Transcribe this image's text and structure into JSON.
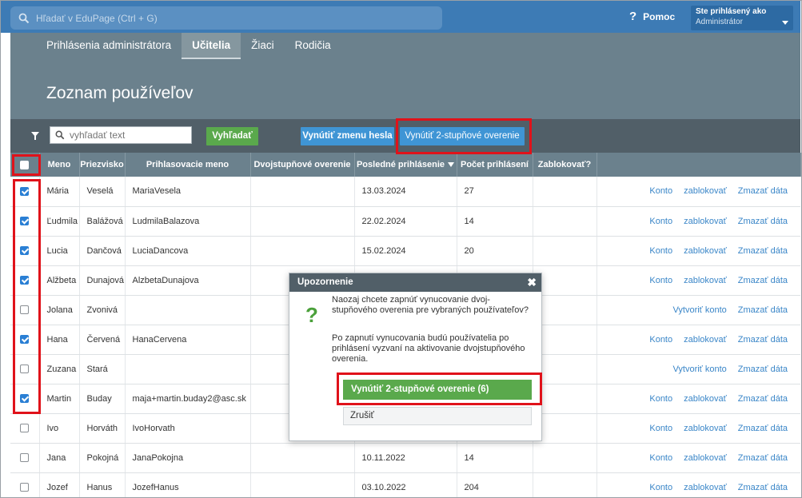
{
  "topbar": {
    "search_placeholder": "Hľadať v EduPage (Ctrl + G)",
    "help_label": "Pomoc",
    "user_label": "Ste prihlásený ako",
    "user_role": "Administrátor"
  },
  "tabs": [
    {
      "label": "Prihlásenia administrátora",
      "active": false
    },
    {
      "label": "Učitelia",
      "active": true
    },
    {
      "label": "Žiaci",
      "active": false
    },
    {
      "label": "Rodičia",
      "active": false
    }
  ],
  "page_title": "Zoznam používeľov",
  "toolbar": {
    "search_placeholder": "vyhľadať text",
    "search_button": "Vyhľadať",
    "reset_password_button": "Vynútiť zmenu hesla",
    "force_2fa_button": "Vynútiť 2-stupňové overenie"
  },
  "table": {
    "headers": [
      "Meno",
      "Priezvisko",
      "Prihlasovacie meno",
      "Dvojstupňové overenie",
      "Posledné prihlásenie",
      "Počet prihlásení",
      "Zablokovať?"
    ],
    "rows": [
      {
        "checked": true,
        "first": "Mária",
        "last": "Veselá",
        "login": "MariaVesela",
        "last_login": "13.03.2024",
        "count": "27",
        "actions": [
          "Konto",
          "zablokovať",
          "Zmazať dáta"
        ]
      },
      {
        "checked": true,
        "first": "Ľudmila",
        "last": "Balážová",
        "login": "LudmilaBalazova",
        "last_login": "22.02.2024",
        "count": "14",
        "actions": [
          "Konto",
          "zablokovať",
          "Zmazať dáta"
        ]
      },
      {
        "checked": true,
        "first": "Lucia",
        "last": "Dančová",
        "login": "LuciaDancova",
        "last_login": "15.02.2024",
        "count": "20",
        "actions": [
          "Konto",
          "zablokovať",
          "Zmazať dáta"
        ]
      },
      {
        "checked": true,
        "first": "Alžbeta",
        "last": "Dunajová",
        "login": "AlzbetaDunajova",
        "last_login": "",
        "count": "",
        "actions": [
          "Konto",
          "zablokovať",
          "Zmazať dáta"
        ]
      },
      {
        "checked": false,
        "first": "Jolana",
        "last": "Zvonivá",
        "login": "",
        "last_login": "",
        "count": "",
        "actions": [
          "Vytvoriť konto",
          "Zmazať dáta"
        ]
      },
      {
        "checked": true,
        "first": "Hana",
        "last": "Červená",
        "login": "HanaCervena",
        "last_login": "",
        "count": "",
        "actions": [
          "Konto",
          "zablokovať",
          "Zmazať dáta"
        ]
      },
      {
        "checked": false,
        "first": "Zuzana",
        "last": "Stará",
        "login": "",
        "last_login": "",
        "count": "",
        "actions": [
          "Vytvoriť konto",
          "Zmazať dáta"
        ]
      },
      {
        "checked": true,
        "first": "Martin",
        "last": "Buday",
        "login": "maja+martin.buday2@asc.sk",
        "last_login": "",
        "count": "",
        "actions": [
          "Konto",
          "zablokovať",
          "Zmazať dáta"
        ]
      },
      {
        "checked": false,
        "first": "Ivo",
        "last": "Horváth",
        "login": "IvoHorvath",
        "last_login": "",
        "count": "",
        "actions": [
          "Konto",
          "zablokovať",
          "Zmazať dáta"
        ]
      },
      {
        "checked": false,
        "first": "Jana",
        "last": "Pokojná",
        "login": "JanaPokojna",
        "last_login": "10.11.2022",
        "count": "14",
        "actions": [
          "Konto",
          "zablokovať",
          "Zmazať dáta"
        ]
      },
      {
        "checked": false,
        "first": "Jozef",
        "last": "Hanus",
        "login": "JozefHanus",
        "last_login": "03.10.2022",
        "count": "204",
        "actions": [
          "Konto",
          "zablokovať",
          "Zmazať dáta"
        ]
      }
    ]
  },
  "dialog": {
    "title": "Upozornenie",
    "icon": "question-icon",
    "text1": "Naozaj chcete zapnúť vynucovanie dvoj-stupňového overenia pre vybraných používateľov?",
    "text2": "Po zapnutí vynucovania budú používatelia po prihlásení vyzvaní na aktivovanie dvojstupňového overenia.",
    "confirm_button": "Vynútiť 2-stupňové overenie (6)",
    "cancel_button": "Zrušiť"
  },
  "colors": {
    "topbar": "#3d7bb5",
    "header": "#6b818d",
    "toolbar": "#515f68",
    "green": "#5aa94c",
    "blue": "#3f95d5",
    "link": "#3a86c8",
    "highlight": "#e0121a"
  }
}
